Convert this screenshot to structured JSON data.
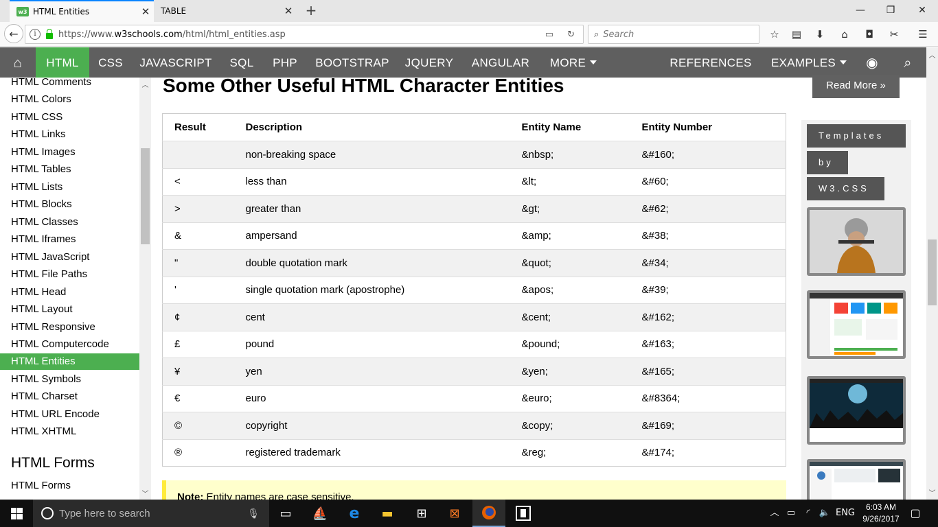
{
  "browser": {
    "tabs": [
      {
        "title": "HTML Entities",
        "favicon": "w3"
      },
      {
        "title": "TABLE"
      }
    ],
    "url_prefix": "https://www.",
    "url_domain": "w3schools.com",
    "url_path": "/html/html_entities.asp",
    "search_placeholder": "Search"
  },
  "topnav": {
    "items": [
      "HTML",
      "CSS",
      "JAVASCRIPT",
      "SQL",
      "PHP",
      "BOOTSTRAP",
      "JQUERY",
      "ANGULAR",
      "MORE"
    ],
    "right_items": [
      "REFERENCES",
      "EXAMPLES"
    ],
    "active": "HTML",
    "accent_color": "#4CAF50"
  },
  "sidebar": {
    "links": [
      "HTML Comments",
      "HTML Colors",
      "HTML CSS",
      "HTML Links",
      "HTML Images",
      "HTML Tables",
      "HTML Lists",
      "HTML Blocks",
      "HTML Classes",
      "HTML Iframes",
      "HTML JavaScript",
      "HTML File Paths",
      "HTML Head",
      "HTML Layout",
      "HTML Responsive",
      "HTML Computercode",
      "HTML Entities",
      "HTML Symbols",
      "HTML Charset",
      "HTML URL Encode",
      "HTML XHTML"
    ],
    "active_link": "HTML Entities",
    "section_heading": "HTML Forms",
    "section_links": [
      "HTML Forms"
    ]
  },
  "main": {
    "title": "Some Other Useful HTML Character Entities",
    "table": {
      "headers": [
        "Result",
        "Description",
        "Entity Name",
        "Entity Number"
      ],
      "rows": [
        [
          "",
          "non-breaking space",
          "&nbsp;",
          "&#160;"
        ],
        [
          "<",
          "less than",
          "&lt;",
          "&#60;"
        ],
        [
          ">",
          "greater than",
          "&gt;",
          "&#62;"
        ],
        [
          "&",
          "ampersand",
          "&amp;",
          "&#38;"
        ],
        [
          "\"",
          "double quotation mark",
          "&quot;",
          "&#34;"
        ],
        [
          "'",
          "single quotation mark (apostrophe)",
          "&apos;",
          "&#39;"
        ],
        [
          "¢",
          "cent",
          "&cent;",
          "&#162;"
        ],
        [
          "£",
          "pound",
          "&pound;",
          "&#163;"
        ],
        [
          "¥",
          "yen",
          "&yen;",
          "&#165;"
        ],
        [
          "€",
          "euro",
          "&euro;",
          "&#8364;"
        ],
        [
          "©",
          "copyright",
          "&copy;",
          "&#169;"
        ],
        [
          "®",
          "registered trademark",
          "&reg;",
          "&#174;"
        ]
      ]
    },
    "note_label": "Note:",
    "note_text": " Entity names are case sensitive."
  },
  "right": {
    "read_more": "Read More »",
    "template_tags": [
      "Templates",
      "by",
      "W3.CSS"
    ]
  },
  "taskbar": {
    "search_placeholder": "Type here to search",
    "language": "ENG",
    "time": "6:03 AM",
    "date": "9/26/2017"
  }
}
